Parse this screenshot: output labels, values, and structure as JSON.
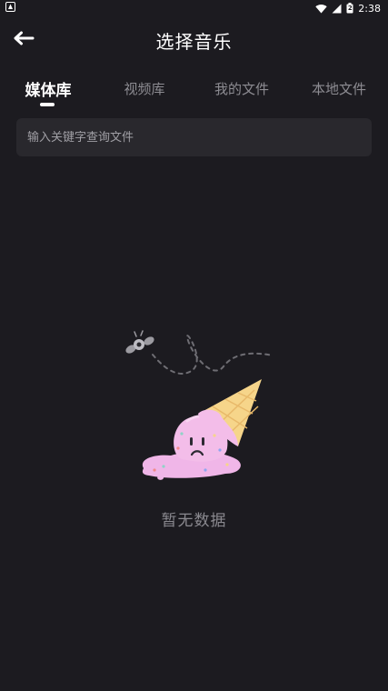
{
  "status_bar": {
    "app_icon": "android-notification-icon",
    "battery_level": "2",
    "time": "2:38"
  },
  "header": {
    "back_icon": "arrow-left-icon",
    "title": "选择音乐"
  },
  "tabs": [
    {
      "label": "媒体库",
      "active": true
    },
    {
      "label": "视频库",
      "active": false
    },
    {
      "label": "我的文件",
      "active": false
    },
    {
      "label": "本地文件",
      "active": false
    }
  ],
  "search": {
    "placeholder": "输入关键字查询文件",
    "value": ""
  },
  "empty_state": {
    "illustration": "melted-ice-cream-with-fly",
    "message": "暂无数据"
  },
  "colors": {
    "background": "#1c1b20",
    "search_bg": "#29282d",
    "active_tab": "#ffffff",
    "inactive_tab": "#8d8c92",
    "empty_text": "#8a898f",
    "ice_cream_pink": "#f0b6e8",
    "cone_yellow": "#f6d58a"
  }
}
